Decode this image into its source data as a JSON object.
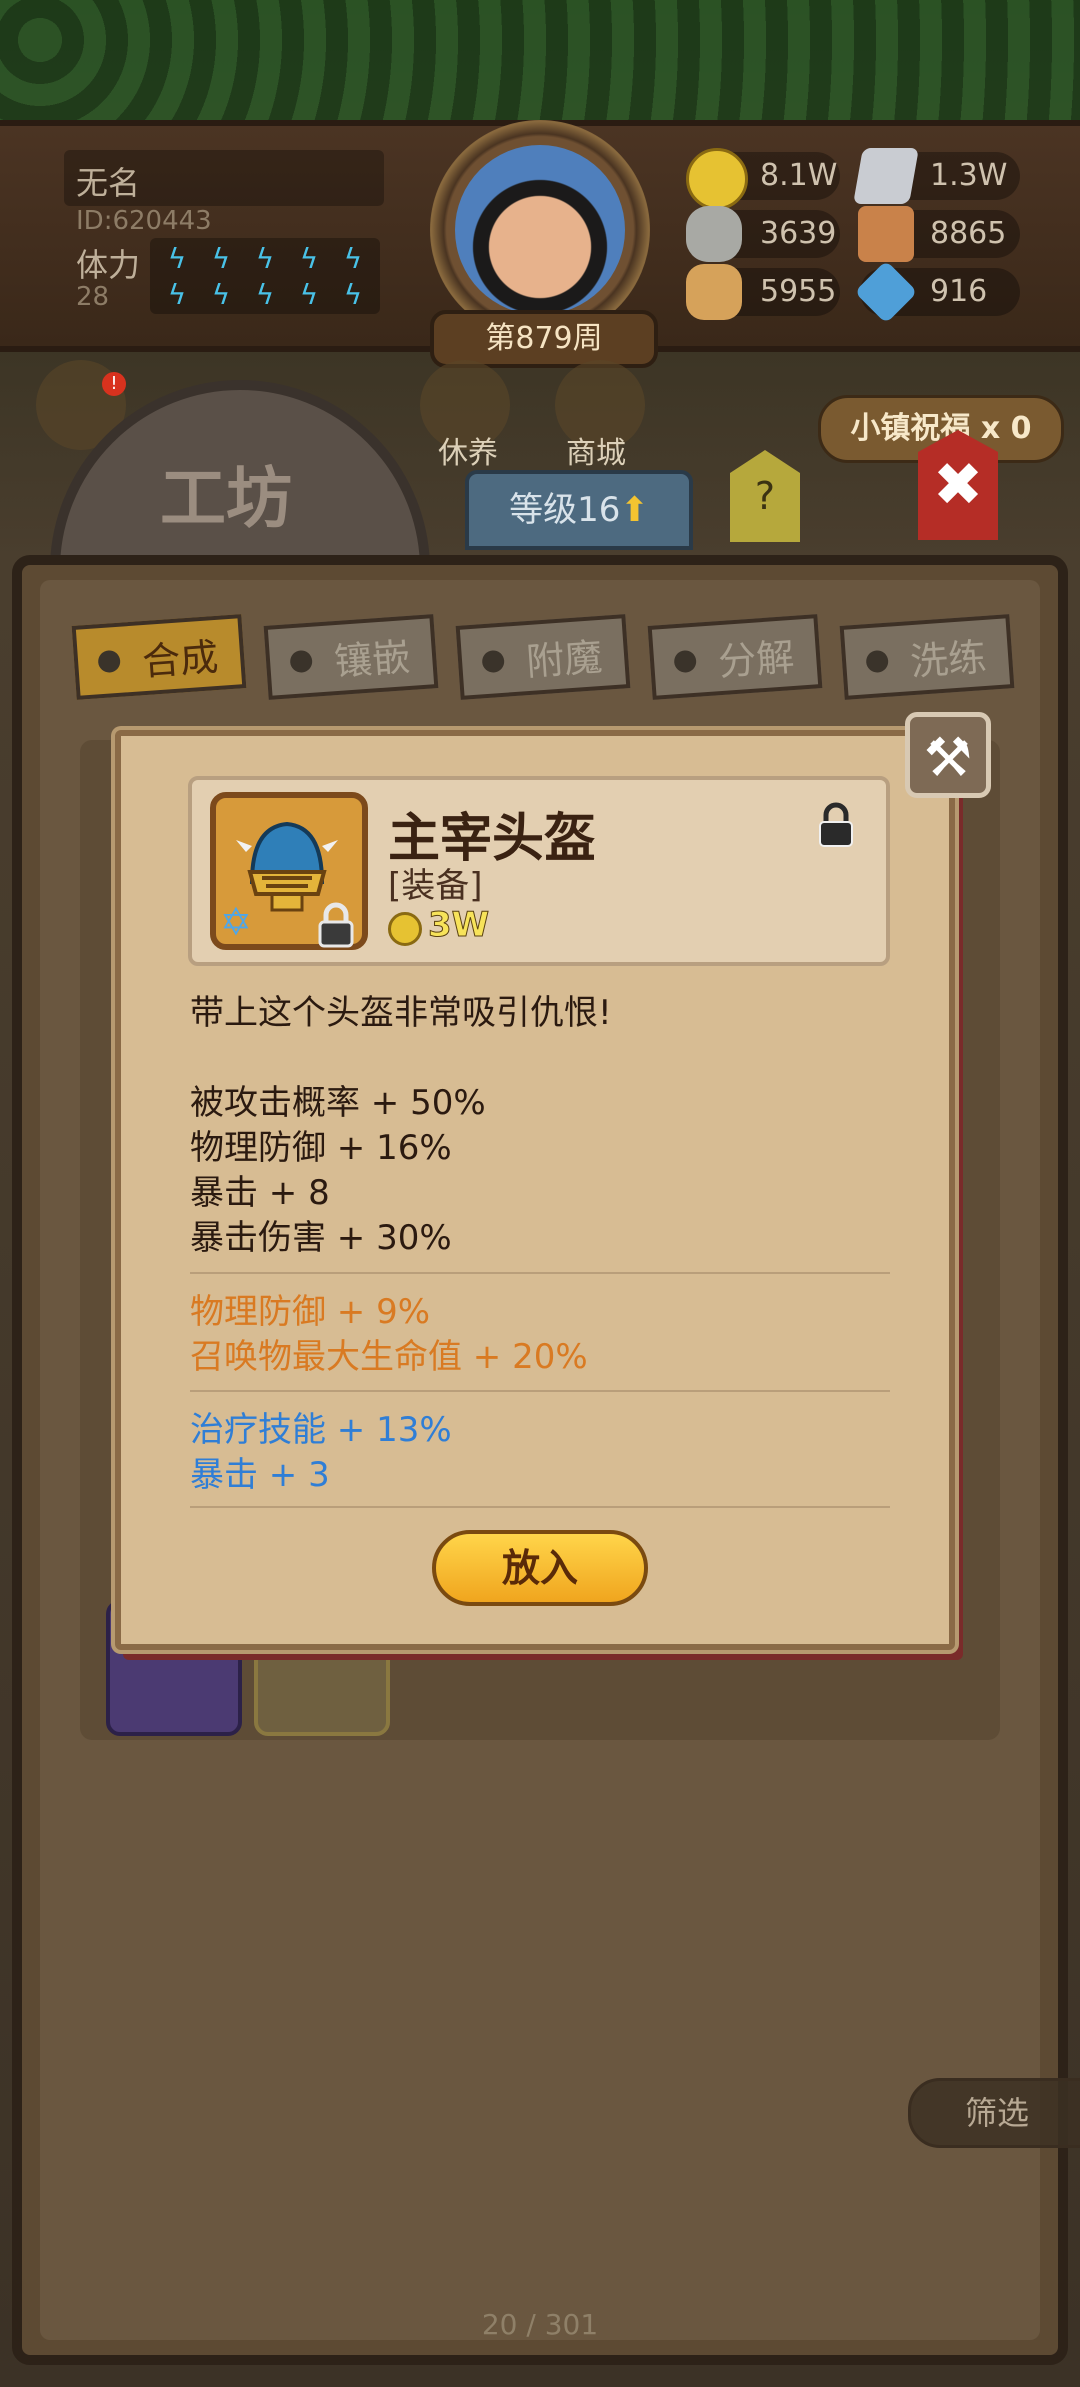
{
  "player": {
    "name": "无名",
    "id": "ID:620443",
    "stamina_label": "体力",
    "stamina_value": "28",
    "week": "第879周"
  },
  "resources": [
    {
      "icon": "gold-coin-icon",
      "value": "8.1W"
    },
    {
      "icon": "iron-ingot-icon",
      "value": "1.3W"
    },
    {
      "icon": "stone-ore-icon",
      "value": "3639"
    },
    {
      "icon": "leather-icon",
      "value": "8865"
    },
    {
      "icon": "wood-log-icon",
      "value": "5955"
    },
    {
      "icon": "blue-crystal-icon",
      "value": "916"
    }
  ],
  "nav": {
    "rest_label": "休养",
    "shop_label": "商城",
    "blessing_label": "小镇祝福 x 0",
    "workshop_title": "工坊",
    "level_label": "等级16",
    "help_label": "?"
  },
  "tabs": [
    {
      "label": "合成",
      "active": true
    },
    {
      "label": "镶嵌",
      "active": false
    },
    {
      "label": "附魔",
      "active": false
    },
    {
      "label": "分解",
      "active": false
    },
    {
      "label": "洗练",
      "active": false
    }
  ],
  "list": {
    "filter_label": "筛选",
    "pager": "20 / 301"
  },
  "item": {
    "name": "主宰头盔",
    "type": "[装备]",
    "price": "3W",
    "description": "带上这个头盔非常吸引仇恨!",
    "base_stats": [
      "被攻击概率 + 50%",
      "物理防御 + 16%",
      "暴击 + 8",
      "暴击伤害 + 30%"
    ],
    "orange_stats": [
      "物理防御 + 9%",
      "召唤物最大生命值 + 20%"
    ],
    "blue_stats": [
      "治疗技能 + 13%",
      "暴击 + 3"
    ],
    "place_button": "放入"
  },
  "colors": {
    "orange_stat": "#d97a22",
    "blue_stat": "#2f7ed6",
    "active_tab": "#b88b2c",
    "close_red": "#b52d26"
  }
}
